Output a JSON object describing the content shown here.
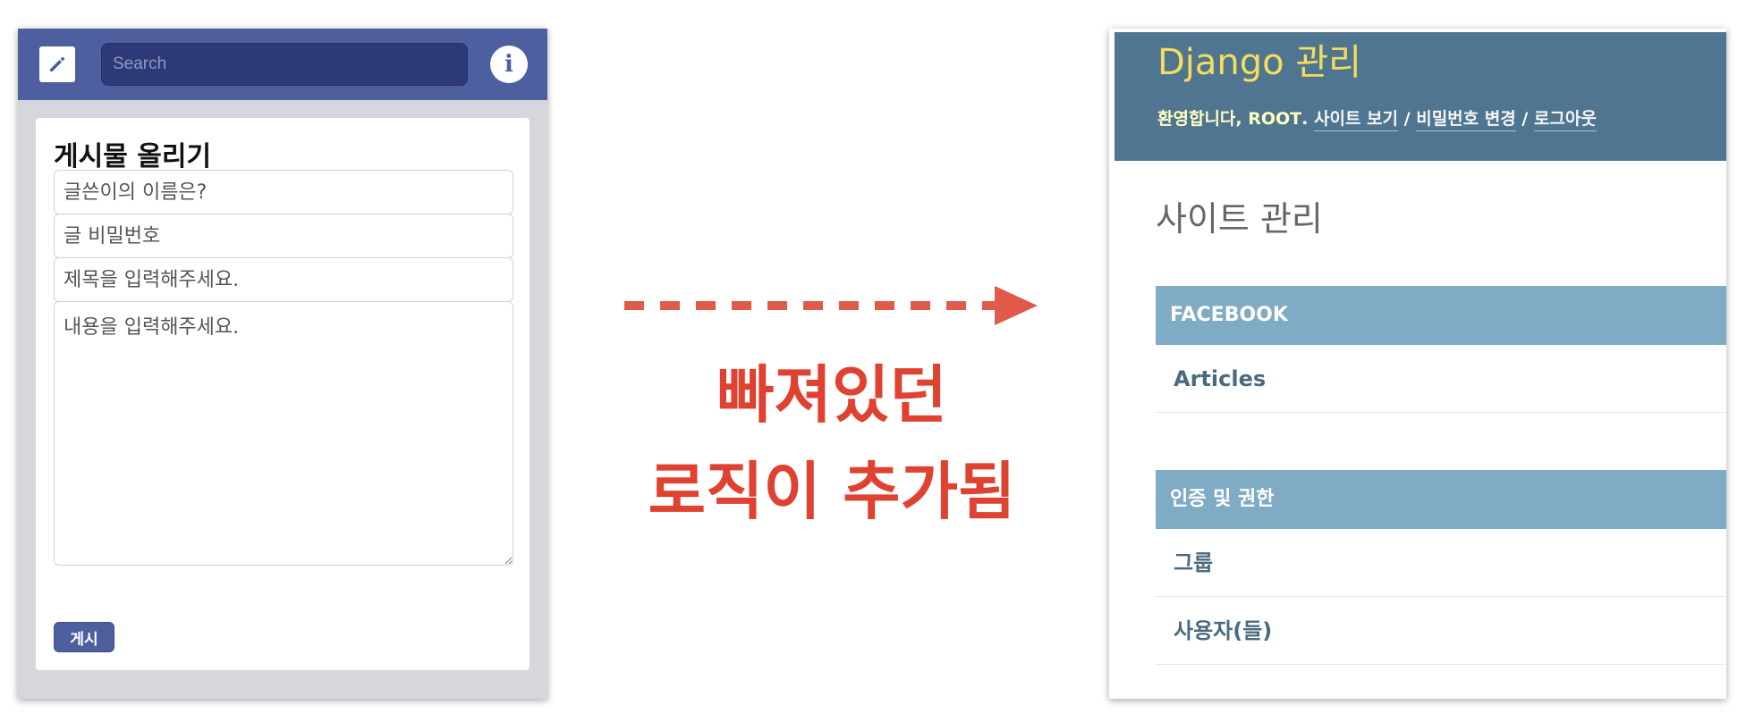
{
  "left_app": {
    "search": {
      "placeholder": "Search"
    },
    "form": {
      "title": "게시물 올리기",
      "name_placeholder": "글쓴이의 이름은?",
      "password_placeholder": "글 비밀번호",
      "subject_placeholder": "제목을 입력해주세요.",
      "content_placeholder": "내용을 입력해주세요.",
      "submit_label": "게시"
    },
    "colors": {
      "topbar": "#4e5fa0",
      "background": "#d5d7dc"
    },
    "icons": [
      "pencil-icon",
      "info-icon"
    ]
  },
  "caption": {
    "line1": "빠져있던",
    "line2": "로직이 추가됨",
    "color": "#e04232"
  },
  "django_admin": {
    "branding": "Django 관리",
    "user_tools": {
      "welcome": "환영합니다,",
      "username": "ROOT",
      "view_site": "사이트 보기",
      "change_password": "비밀번호 변경",
      "logout": "로그아웃",
      "separator": "/"
    },
    "subtitle": "사이트 관리",
    "modules": [
      {
        "caption": "FACEBOOK",
        "models": [
          "Articles"
        ]
      },
      {
        "caption": "인증 및 권한",
        "models": [
          "그룹",
          "사용자(들)"
        ]
      }
    ],
    "colors": {
      "header": "#4f7590",
      "branding": "#f5dd5d",
      "module_caption": "#7fabc5",
      "link": "#4a6a80"
    }
  }
}
